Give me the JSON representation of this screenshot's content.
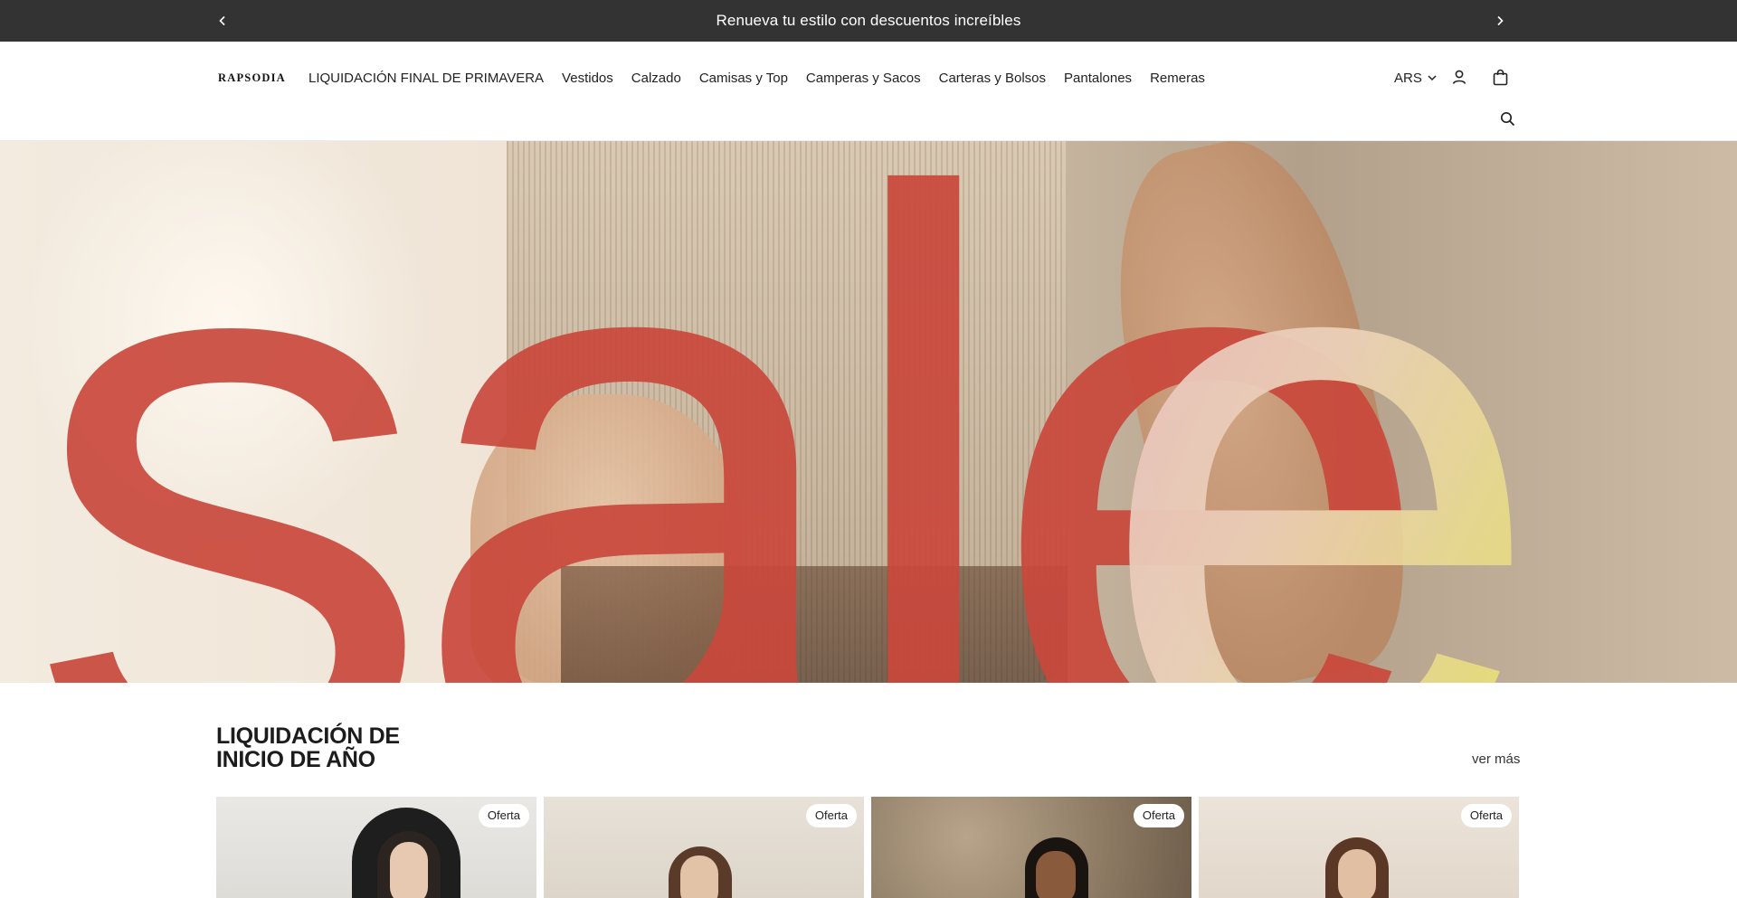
{
  "announcement": {
    "text": "Renueva tu estilo con descuentos increíbles",
    "prev_icon": "chevron-left-icon",
    "next_icon": "chevron-right-icon"
  },
  "header": {
    "logo_text": "RAPSODIA",
    "nav": [
      "LIQUIDACIÓN FINAL DE PRIMAVERA",
      "Vestidos",
      "Calzado",
      "Camisas y Top",
      "Camperas y Sacos",
      "Carteras y Bolsos",
      "Pantalones",
      "Remeras"
    ],
    "currency": "ARS",
    "icons": [
      "chevron-down-icon",
      "account-icon",
      "cart-icon",
      "search-icon"
    ]
  },
  "hero": {
    "text": "sale",
    "colors": {
      "letters_red": "#c9483c",
      "letters_gradient_start": "#e8b8c0",
      "letters_gradient_end": "#e3e35a"
    }
  },
  "section": {
    "title_line1": "LIQUIDACIÓN DE",
    "title_line2": "INICIO DE AÑO",
    "see_more": "ver más"
  },
  "products": [
    {
      "badge": "Oferta"
    },
    {
      "badge": "Oferta"
    },
    {
      "badge": "Oferta"
    },
    {
      "badge": "Oferta"
    }
  ],
  "colors": {
    "announcement_bg": "#333333",
    "text": "#1f1f1f",
    "background": "#ffffff"
  }
}
